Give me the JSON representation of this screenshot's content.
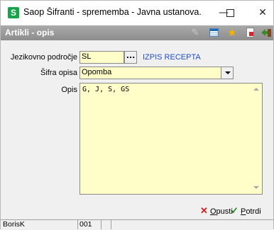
{
  "window": {
    "title": "Saop Šifranti - sprememba - Javna ustanova...",
    "app_icon_letter": "S",
    "minimize": "—",
    "close": "✕"
  },
  "header": {
    "title": "Artikli - opis",
    "icons": [
      "edit-icon",
      "grid-icon",
      "favorite-star-icon",
      "report-icon",
      "exit-icon"
    ]
  },
  "form": {
    "jezikovno_label": "Jezikovno področje",
    "jezikovno_value": "SL",
    "lookup_button": "...",
    "izpis_link": "IZPIS RECEPTA",
    "sifra_label": "Šifra opisa",
    "sifra_value": "Opomba",
    "opis_label": "Opis",
    "opis_value": "G, J, S, GS"
  },
  "actions": {
    "opusti_prefix": "",
    "opusti_accel": "O",
    "opusti_rest": "pusti",
    "potrdi_accel": "P",
    "potrdi_rest": "otrdi"
  },
  "status": {
    "user": "BorisK",
    "code": "001"
  },
  "colors": {
    "field_bg": "#fffec8",
    "header_bg": "#999999",
    "link": "#1f4ec8",
    "cancel": "#d32020",
    "confirm": "#1d8a1d"
  }
}
